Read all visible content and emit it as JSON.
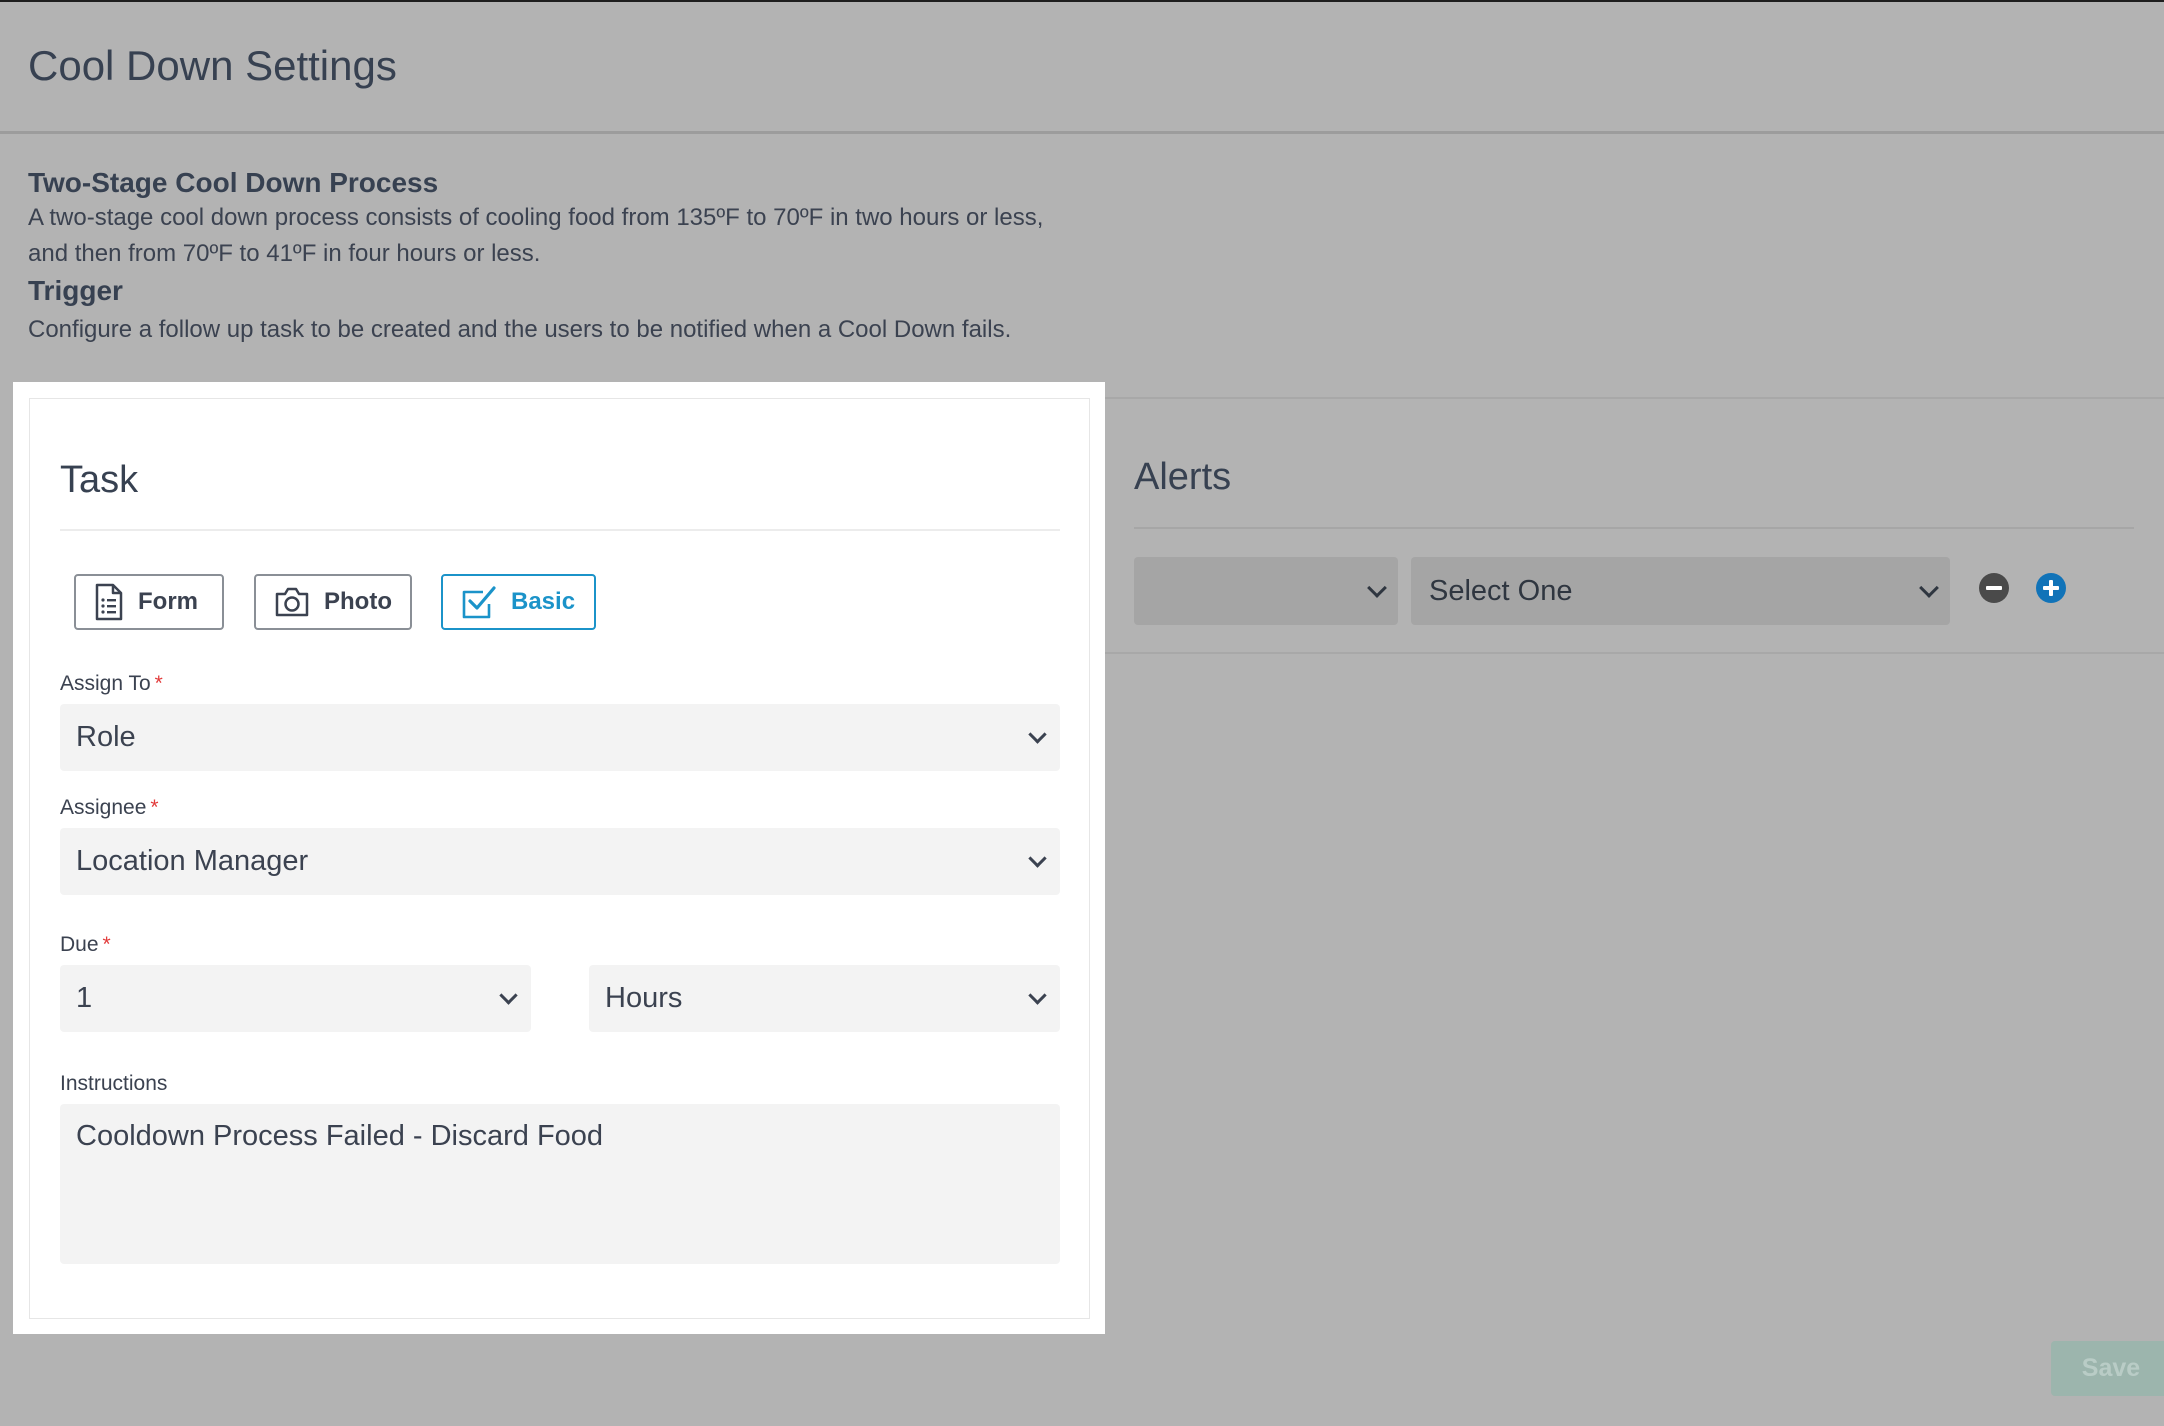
{
  "page": {
    "title": "Cool Down Settings"
  },
  "info": {
    "process_heading": "Two-Stage Cool Down Process",
    "process_text": "A two-stage cool down process consists of cooling food from 135ºF to 70ºF in two hours or less, and then from 70ºF to 41ºF in four hours or less.",
    "trigger_heading": "Trigger",
    "trigger_text": "Configure a follow up task to be created and the users to be notified when a Cool Down fails."
  },
  "task": {
    "title": "Task",
    "types": [
      {
        "label": "Form",
        "icon": "form-icon",
        "selected": false
      },
      {
        "label": "Photo",
        "icon": "camera-icon",
        "selected": false
      },
      {
        "label": "Basic",
        "icon": "checkbox-icon",
        "selected": true
      }
    ],
    "assign_to": {
      "label": "Assign To",
      "required_mark": "*",
      "value": "Role"
    },
    "assignee": {
      "label": "Assignee",
      "required_mark": "*",
      "value": "Location Manager"
    },
    "due": {
      "label": "Due",
      "required_mark": "*",
      "amount": "1",
      "unit": "Hours"
    },
    "instructions": {
      "label": "Instructions",
      "value": "Cooldown Process Failed - Discard Food"
    }
  },
  "alerts": {
    "title": "Alerts",
    "first_select_value": "",
    "second_select_value": "Select One",
    "remove_icon": "minus-circle-icon",
    "add_icon": "plus-circle-icon"
  },
  "actions": {
    "save_label": "Save"
  },
  "colors": {
    "accent": "#1b93c9",
    "overlay": "#b3b3b3",
    "required": "#e23b3b",
    "add": "#1173b8"
  }
}
